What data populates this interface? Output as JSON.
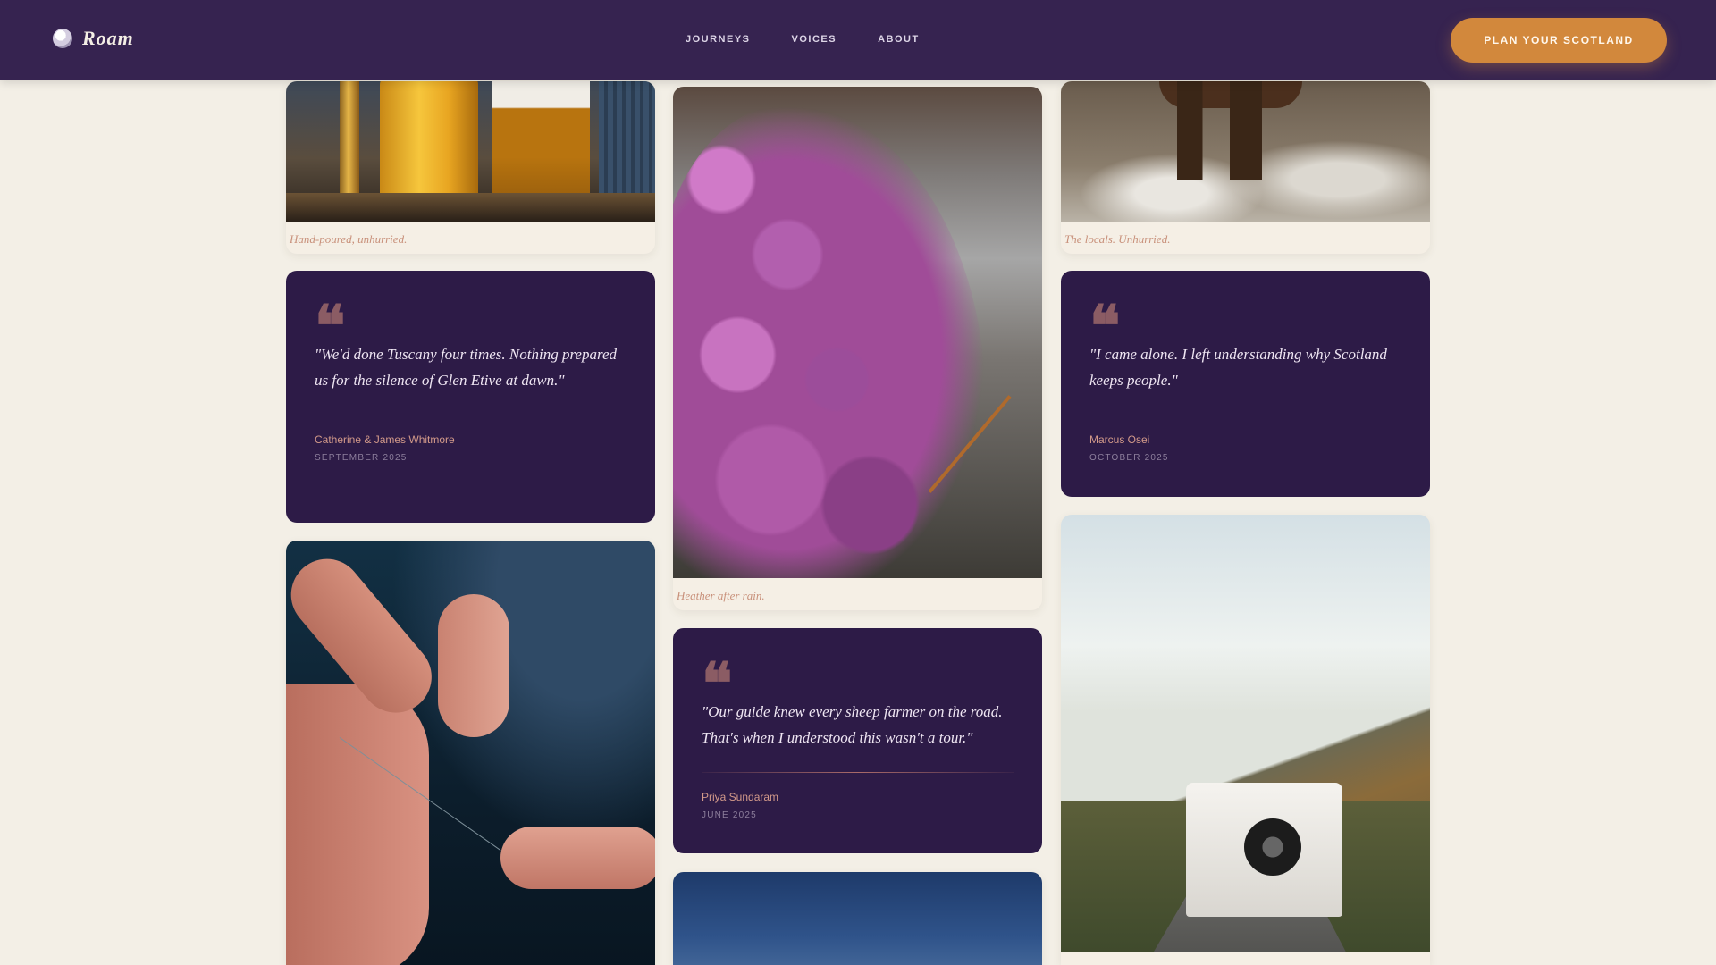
{
  "header": {
    "brand": "Roam",
    "nav": [
      "JOURNEYS",
      "VOICES",
      "ABOUT"
    ],
    "cta": "PLAN YOUR SCOTLAND"
  },
  "gallery": {
    "captions": {
      "whisky": "Hand-poured, unhurried.",
      "heather": "Heather after rain.",
      "cow": "The locals. Unhurried."
    },
    "testimonials": [
      {
        "quote": "\"We'd done Tuscany four times. Nothing prepared us for the silence of Glen Etive at dawn.\"",
        "name": "Catherine & James Whitmore",
        "date": "SEPTEMBER 2025"
      },
      {
        "quote": "\"Our guide knew every sheep farmer on the road. That's when I understood this wasn't a tour.\"",
        "name": "Priya Sundaram",
        "date": "JUNE 2025"
      },
      {
        "quote": "\"I came alone. I left understanding why Scotland keeps people.\"",
        "name": "Marcus Osei",
        "date": "OCTOBER 2025"
      }
    ],
    "quote_glyph": "❝"
  },
  "colors": {
    "nav_bg": "#301c4a",
    "cta": "#d2883c",
    "quote_card_bg": "#2d1b47",
    "page_bg": "#f3efe6",
    "caption": "#c8907a"
  }
}
